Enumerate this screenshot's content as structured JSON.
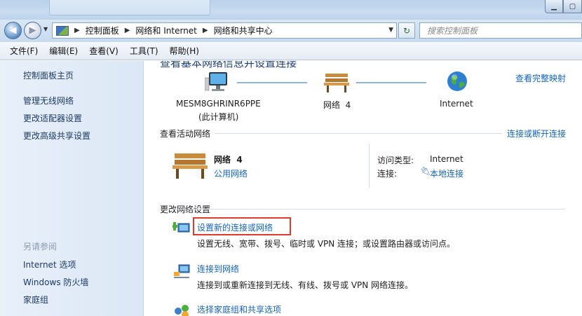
{
  "address_bar": {
    "crumbs": [
      "控制面板",
      "网络和 Internet",
      "网络和共享中心"
    ],
    "search_placeholder": "搜索控制面板"
  },
  "menu": [
    "文件(F)",
    "编辑(E)",
    "查看(V)",
    "工具(T)",
    "帮助(H)"
  ],
  "sidebar": {
    "links": [
      "控制面板主页",
      "管理无线网络",
      "更改适配器设置",
      "更改高级共享设置"
    ],
    "see_also_heading": "另请参阅",
    "see_also": [
      "Internet 选项",
      "Windows 防火墙",
      "家庭组"
    ]
  },
  "main": {
    "heading": "查看基本网络信息并设置连接",
    "view_full_map": "查看完整映射",
    "map": {
      "computer_name": "MESM8GHRINR6PPE",
      "computer_sub": "(此计算机)",
      "network_name": "网络  4",
      "internet": "Internet"
    },
    "active": {
      "title": "查看活动网络",
      "connect_disconnect": "连接或断开连接",
      "network_name": "网络  4",
      "network_type": "公用网络",
      "access_label": "访问类型:",
      "access_value": "Internet",
      "conn_label": "连接:",
      "conn_value": "本地连接"
    },
    "change": {
      "title": "更改网络设置",
      "items": [
        {
          "link": "设置新的连接或网络",
          "desc": "设置无线、宽带、拨号、临时或 VPN 连接；或设置路由器或访问点。"
        },
        {
          "link": "连接到网络",
          "desc": "连接到或重新连接到无线、有线、拨号或 VPN 网络连接。"
        },
        {
          "link": "选择家庭组和共享选项",
          "desc": ""
        }
      ]
    }
  },
  "colors": {
    "highlight_box": "#e03a2e",
    "link": "#1665b8"
  }
}
